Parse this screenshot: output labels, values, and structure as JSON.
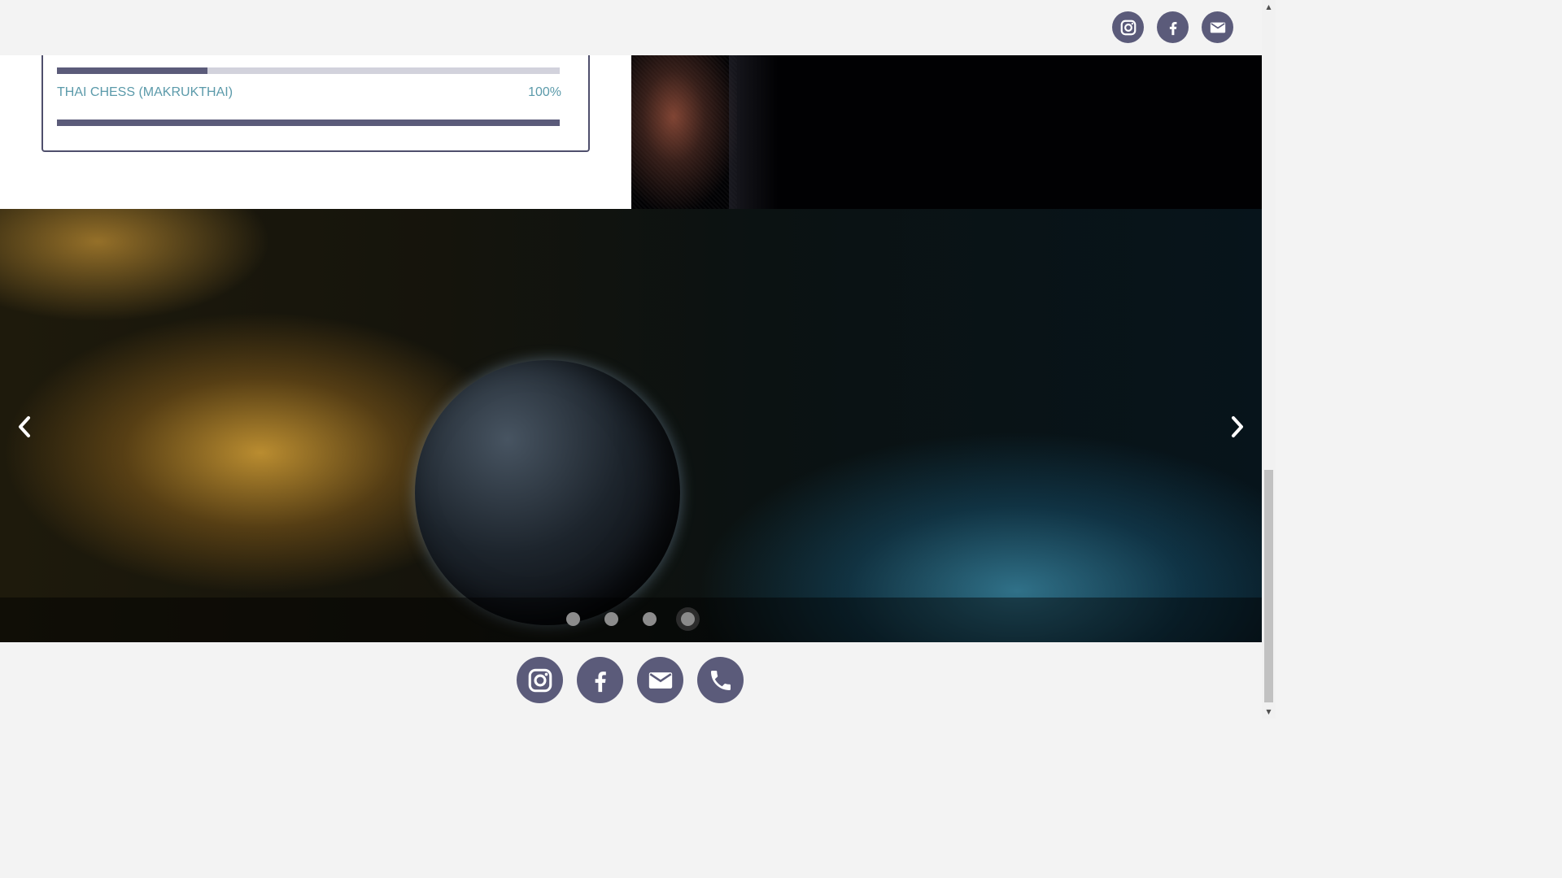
{
  "header": {
    "social": [
      {
        "icon": "instagram-icon"
      },
      {
        "icon": "facebook-icon"
      },
      {
        "icon": "mail-icon"
      }
    ]
  },
  "skills": {
    "previous_bar_progress": 0.3,
    "items": [
      {
        "label": "THAI CHESS (MAKRUKTHAI)",
        "percent": "100%",
        "progress": 1.0
      }
    ]
  },
  "carousel": {
    "slide_count": 4,
    "active_index": 3,
    "prev_icon": "chevron-left-icon",
    "next_icon": "chevron-right-icon"
  },
  "footer": {
    "social": [
      {
        "icon": "instagram-icon"
      },
      {
        "icon": "facebook-icon"
      },
      {
        "icon": "mail-icon"
      },
      {
        "icon": "phone-icon"
      }
    ]
  },
  "colors": {
    "accent": "#5b5b7a",
    "skill_text": "#5b9aaa",
    "track": "#d2d2dc"
  }
}
